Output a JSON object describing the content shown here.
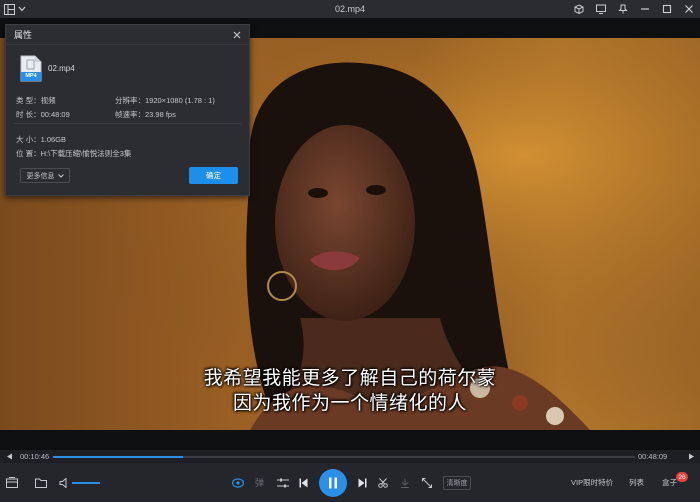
{
  "window": {
    "title": "02.mp4"
  },
  "video": {
    "subtitle_line1": "我希望我能更多了解自己的荷尔蒙",
    "subtitle_line2": "因为我作为一个情绪化的人"
  },
  "dialog": {
    "title": "属性",
    "file_name": "02.mp4",
    "file_badge": "MP4",
    "type": "类 型：视频",
    "duration": "时 长：00:48:09",
    "resolution": "分辨率：1920×1080 (1.78 : 1)",
    "framerate": "帧速率：23.98 fps",
    "size": "大 小：1.06GB",
    "location": "位 置：H:\\下载压缩\\愉悦法则全3集",
    "more_info": "更多信息",
    "ok": "确定"
  },
  "progress": {
    "current": "00:10:46",
    "total": "00:48:09",
    "fraction": 0.224
  },
  "controls": {
    "danmu": "弹",
    "quality": "清晰度",
    "vip": "VIP限时特价",
    "list": "列表",
    "box": "盒子",
    "box_badge": "26",
    "accent": "#2a8fe6"
  }
}
